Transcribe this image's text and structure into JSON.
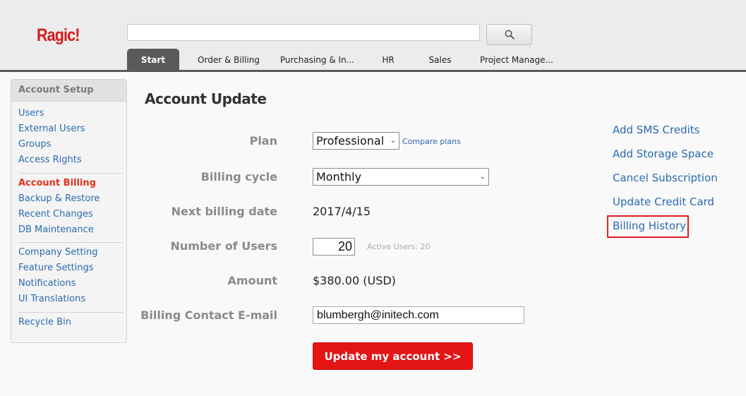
{
  "app": {
    "logo": "Ragic!"
  },
  "search": {
    "value": "",
    "placeholder": ""
  },
  "tabs": [
    {
      "label": "Start",
      "active": true
    },
    {
      "label": "Order & Billing"
    },
    {
      "label": "Purchasing & In..."
    },
    {
      "label": "HR"
    },
    {
      "label": "Sales"
    },
    {
      "label": "Project Manage..."
    }
  ],
  "sidebar": {
    "title": "Account Setup",
    "items": [
      {
        "label": "Users"
      },
      {
        "label": "External Users"
      },
      {
        "label": "Groups"
      },
      {
        "label": "Access Rights"
      },
      {
        "label": "Account Billing",
        "active": true
      },
      {
        "label": "Backup & Restore"
      },
      {
        "label": "Recent Changes"
      },
      {
        "label": "DB Maintenance"
      },
      {
        "label": "Company Setting"
      },
      {
        "label": "Feature Settings"
      },
      {
        "label": "Notifications"
      },
      {
        "label": "UI Translations"
      },
      {
        "label": "Recycle Bin"
      }
    ]
  },
  "main": {
    "title": "Account Update",
    "plan": {
      "label": "Plan",
      "value": "Professional",
      "compare_link": "Compare plans"
    },
    "billing_cycle": {
      "label": "Billing cycle",
      "value": "Monthly"
    },
    "next_billing_date": {
      "label": "Next billing date",
      "value": "2017/4/15"
    },
    "number_of_users": {
      "label": "Number of Users",
      "value": "20",
      "active_users": "Active Users: 20"
    },
    "amount": {
      "label": "Amount",
      "value": "$380.00 (USD)"
    },
    "billing_email": {
      "label": "Billing Contact E-mail",
      "value": "blumbergh@initech.com"
    },
    "update_button": "Update my account >>"
  },
  "right_links": [
    {
      "label": "Add SMS Credits"
    },
    {
      "label": "Add Storage Space"
    },
    {
      "label": "Cancel Subscription"
    },
    {
      "label": "Update Credit Card"
    },
    {
      "label": "Billing History",
      "highlighted": true
    }
  ],
  "colors": {
    "brand": "#d81b1b",
    "link": "#2a6ab0",
    "active_sidebar": "#e0321c",
    "primary_button": "#e41515",
    "highlight": "#e01e1e",
    "tab_active": "#5a5a5a"
  }
}
